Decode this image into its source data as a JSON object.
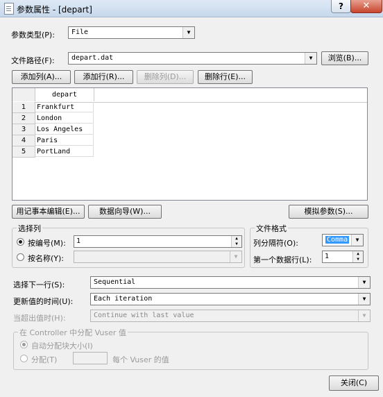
{
  "window": {
    "title": "参数属性 - [depart]",
    "help": "?",
    "close": "✕"
  },
  "param_type": {
    "label": "参数类型(P):",
    "value": "File"
  },
  "file_path": {
    "label": "文件路径(F):",
    "value": "depart.dat",
    "browse": "浏览(B)..."
  },
  "toolbar": {
    "add_column": "添加列(A)...",
    "add_row": "添加行(R)...",
    "delete_column": "删除列(D)...",
    "delete_row": "删除行(E)..."
  },
  "table": {
    "column": "depart",
    "rows": [
      {
        "num": "1",
        "value": "Frankfurt"
      },
      {
        "num": "2",
        "value": "London"
      },
      {
        "num": "3",
        "value": "Los Angeles"
      },
      {
        "num": "4",
        "value": "Paris"
      },
      {
        "num": "5",
        "value": "PortLand"
      }
    ]
  },
  "actions": {
    "edit_notepad": "用记事本编辑(E)...",
    "data_wizard": "数据向导(W)...",
    "simulate": "模拟参数(S)..."
  },
  "select_column": {
    "title": "选择列",
    "by_number": "按编号(M):",
    "by_number_value": "1",
    "by_name": "按名称(Y):"
  },
  "file_format": {
    "title": "文件格式",
    "delimiter_label": "列分隔符(O):",
    "delimiter_value": "Comma",
    "first_row_label": "第一个数据行(L):",
    "first_row_value": "1"
  },
  "select_next_row": {
    "label": "选择下一行(S):",
    "value": "Sequential"
  },
  "update_value": {
    "label": "更新值的时间(U):",
    "value": "Each iteration"
  },
  "out_of_values": {
    "label": "当超出值时(H):",
    "value": "Continue with last value"
  },
  "controller": {
    "title": "在 Controller 中分配 Vuser 值",
    "auto": "自动分配块大小(I)",
    "allocate": "分配(T)",
    "per_vuser": "每个 Vuser 的值"
  },
  "close_button": "关闭(C)"
}
